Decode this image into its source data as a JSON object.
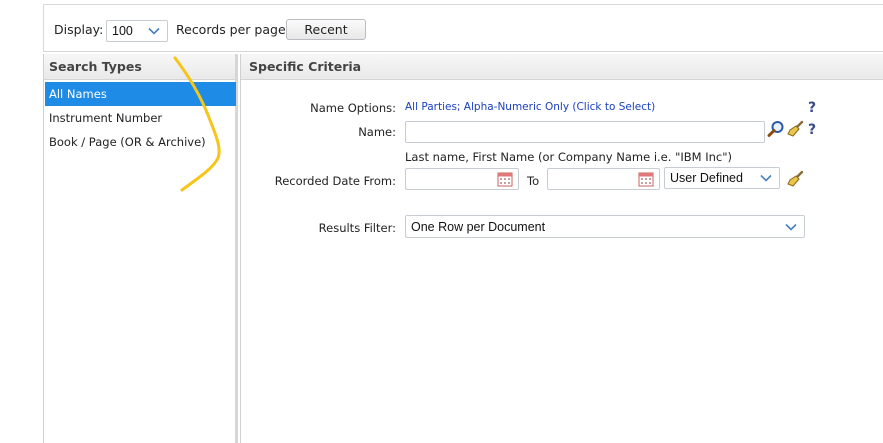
{
  "toolbar": {
    "display_label": "Display:",
    "display_value": "100",
    "records_label": "Records per page",
    "recent_button": "Recent"
  },
  "search_types": {
    "title": "Search Types",
    "items": [
      {
        "label": "All Names",
        "active": true
      },
      {
        "label": "Instrument Number",
        "active": false
      },
      {
        "label": "Book / Page (OR & Archive)",
        "active": false
      }
    ]
  },
  "criteria": {
    "title": "Specific Criteria",
    "name_options_label": "Name Options:",
    "name_options_link": "All Parties; Alpha-Numeric Only (Click to Select)",
    "name_label": "Name:",
    "name_value": "",
    "name_hint": "Last name, First Name (or Company Name i.e. \"IBM Inc\")",
    "date_from_label": "Recorded Date From:",
    "date_from_value": "",
    "to_label": "To",
    "date_to_value": "",
    "date_range_value": "User Defined",
    "results_filter_label": "Results Filter:",
    "results_filter_value": "One Row per Document",
    "help_glyph": "?"
  },
  "colors": {
    "active_item": "#1e8ce6",
    "link": "#1a3fbf",
    "annotation": "#f5c518"
  }
}
